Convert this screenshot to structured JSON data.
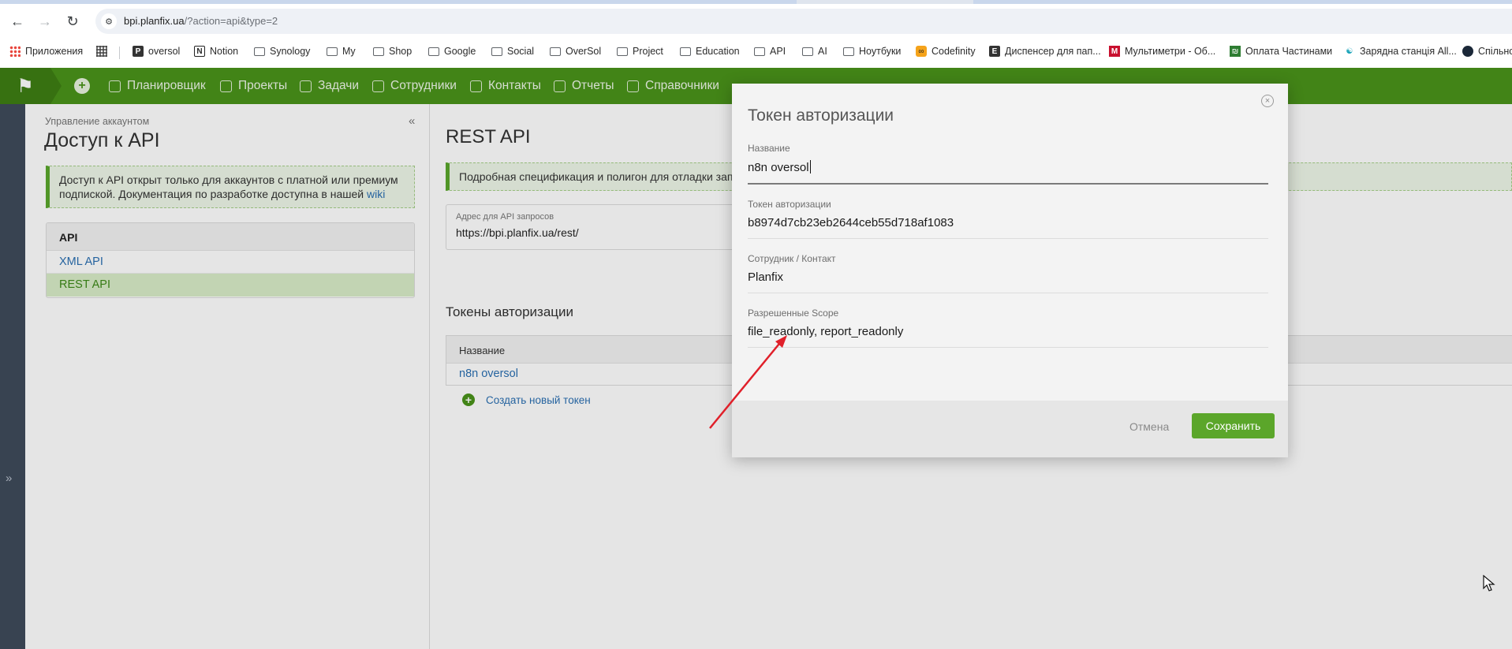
{
  "browser": {
    "url_host": "bpi.planfix.ua",
    "url_path": "/?action=api&type=2"
  },
  "bookmarks": [
    {
      "label": "Приложения",
      "icon": "apps-icon"
    },
    {
      "label": "",
      "icon": "grid-icon"
    },
    {
      "label": "oversol",
      "icon": "oversol-icon"
    },
    {
      "label": "Notion",
      "icon": "notion-icon"
    },
    {
      "label": "Synology",
      "icon": "folder-icon"
    },
    {
      "label": "My",
      "icon": "folder-icon"
    },
    {
      "label": "Shop",
      "icon": "folder-icon"
    },
    {
      "label": "Google",
      "icon": "folder-icon"
    },
    {
      "label": "Social",
      "icon": "folder-icon"
    },
    {
      "label": "OverSol",
      "icon": "folder-icon"
    },
    {
      "label": "Project",
      "icon": "folder-icon"
    },
    {
      "label": "Education",
      "icon": "folder-icon"
    },
    {
      "label": "API",
      "icon": "folder-icon"
    },
    {
      "label": "AI",
      "icon": "folder-icon"
    },
    {
      "label": "Ноутбуки",
      "icon": "folder-icon"
    },
    {
      "label": "Codefinity",
      "icon": "codefinity-icon"
    },
    {
      "label": "Диспенсер для пап...",
      "icon": "dispenser-icon"
    },
    {
      "label": "Мультиметри - Об...",
      "icon": "multimeter-icon"
    },
    {
      "label": "Оплата Частинами",
      "icon": "payment-icon"
    },
    {
      "label": "Зарядна станція All...",
      "icon": "charging-icon"
    },
    {
      "label": "Спільно",
      "icon": "steam-icon"
    }
  ],
  "topmenu": {
    "items": [
      "Планировщик",
      "Проекты",
      "Задачи",
      "Сотрудники",
      "Контакты",
      "Отчеты",
      "Справочники"
    ]
  },
  "left": {
    "breadcrumb": "Управление аккаунтом",
    "title": "Доступ к API",
    "note_text": "Доступ к API открыт только для аккаунтов с платной или премиум подпиской. Документация по разработке доступна в нашей ",
    "note_link": "wiki",
    "api_header": "API",
    "api_items": [
      "XML API",
      "REST API"
    ]
  },
  "main": {
    "title": "REST API",
    "banner": "Подробная спецификация и полигон для отладки запросов",
    "address_label": "Адрес для API запросов",
    "address_value": "https://bpi.planfix.ua/rest/",
    "tokens_title": "Токены авторизации",
    "table_header": "Название",
    "table_row": "n8n oversol",
    "create_token": "Создать новый токен"
  },
  "modal": {
    "title": "Токен авторизации",
    "fields": [
      {
        "label": "Название",
        "value": "n8n oversol"
      },
      {
        "label": "Токен авторизации",
        "value": "b8974d7cb23eb2644ceb55d718af1083"
      },
      {
        "label": "Сотрудник / Контакт",
        "value": "Planfix"
      },
      {
        "label": "Разрешенные Scope",
        "value": "file_readonly, report_readonly"
      }
    ],
    "cancel": "Отмена",
    "save": "Сохранить"
  },
  "colors": {
    "brand_green": "#4a941a",
    "save_button": "#5ba62a",
    "link_blue": "#2a6fb2",
    "annotation_arrow": "#e0202a"
  }
}
